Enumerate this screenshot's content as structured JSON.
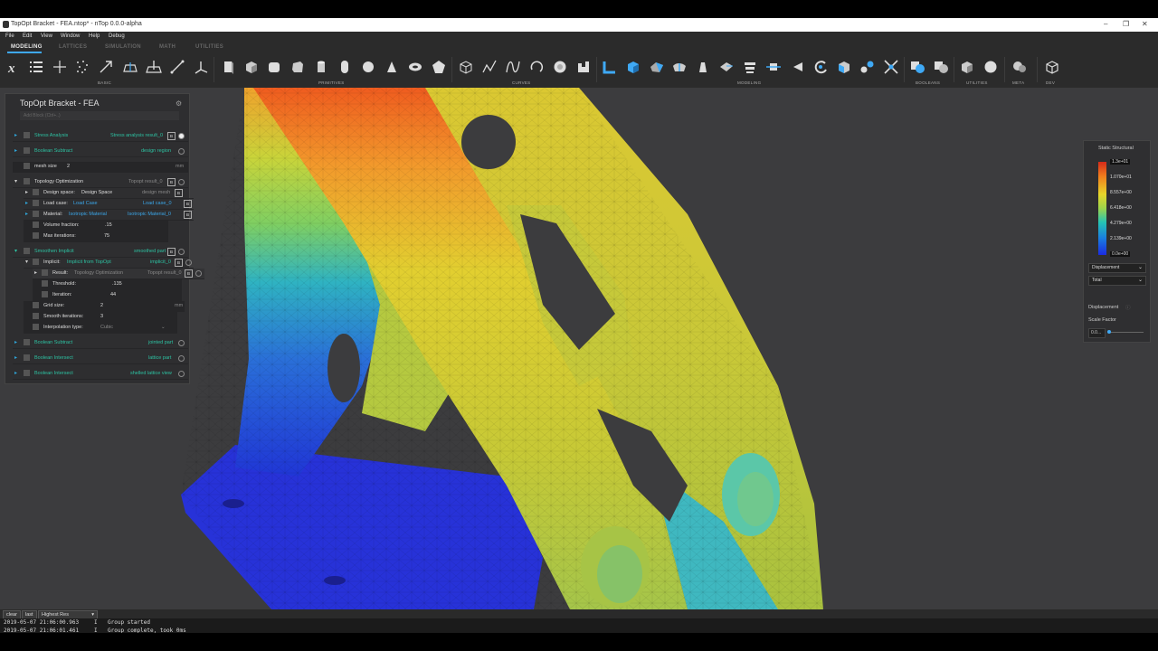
{
  "window": {
    "title": "TopOpt Bracket - FEA.ntop* - nTop 0.0.0-alpha"
  },
  "menu": [
    "File",
    "Edit",
    "View",
    "Window",
    "Help",
    "Debug"
  ],
  "tabs": [
    "MODELING",
    "LATTICES",
    "SIMULATION",
    "MATH",
    "UTILITIES"
  ],
  "toolbar_groups": [
    "BASIC",
    "PRIMITIVES",
    "CURVES",
    "MODELING",
    "BOOLEANS",
    "UTILITIES",
    "META",
    "DEV"
  ],
  "notebook": {
    "title": "TopOpt Bracket - FEA",
    "subtitle": "Add Block   (Ctrl+..)",
    "rows": [
      {
        "name": "Stress Analysis",
        "output": "Stress analysis result_0",
        "badge": "B"
      },
      {
        "name": "Boolean Subtract",
        "output": "design region"
      },
      {
        "name": "mesh size",
        "value": "2",
        "unit": "mm"
      },
      {
        "name": "Topology Optimization",
        "output": "Topopt result_0",
        "badge": "B"
      },
      {
        "name": "Design space:",
        "value": "Design Space",
        "output": "design mesh",
        "badge": "B"
      },
      {
        "name": "Load case:",
        "value": "Load Case",
        "output": "Load case_0",
        "badge": "B"
      },
      {
        "name": "Material:",
        "value": "Isotropic Material",
        "output": "Isotropic Material_0",
        "badge": "B"
      },
      {
        "name": "Volume fraction:",
        "value": ".15"
      },
      {
        "name": "Max iterations:",
        "value": "75"
      },
      {
        "name": "Smoothen Implicit",
        "output": "smoothed part",
        "badge": "B"
      },
      {
        "name": "Implicit:",
        "value": "Implicit from TopOpt",
        "output": "implicit_0",
        "badge": "B"
      },
      {
        "name": "Result:",
        "value": "Topology Optimization",
        "output": "Topopt result_0",
        "badge": "B"
      },
      {
        "name": "Threshold:",
        "value": ".135"
      },
      {
        "name": "Iteration:",
        "value": "44"
      },
      {
        "name": "Grid size:",
        "value": "2",
        "unit": "mm"
      },
      {
        "name": "Smooth iterations:",
        "value": "3"
      },
      {
        "name": "Interpolation type:",
        "value": "Cubic"
      },
      {
        "name": "Boolean Subtract",
        "output": "jointed part"
      },
      {
        "name": "Boolean Intersect",
        "output": "lattice part"
      },
      {
        "name": "Boolean Intersect",
        "output": "shelled lattice view"
      }
    ]
  },
  "legend": {
    "title": "Static Structural",
    "ticks": [
      "1.3e+01",
      "1.070e+01",
      "8.557e+00",
      "6.418e+00",
      "4.279e+00",
      "2.139e+00",
      "0.0e+00"
    ],
    "result_type": "Displacement",
    "component": "Total",
    "section_label": "Displacement",
    "scale_label": "Scale Factor",
    "scale_value": "0.0..."
  },
  "console": {
    "filter_buttons": [
      "clear",
      "last"
    ],
    "level": "Highest Res",
    "lines": [
      {
        "time": "2019-05-07 21:06:00.963",
        "level": "I",
        "msg": "Group started"
      },
      {
        "time": "2019-05-07 21:06:01.461",
        "level": "I",
        "msg": "Group complete, took 0ms"
      }
    ]
  },
  "colors": {
    "accent": "#3fa9f5",
    "teal": "#2dc2a2",
    "blue_link": "#3ba7ea",
    "panel": "#2e2e30",
    "viewport": "#3c3c3e"
  }
}
